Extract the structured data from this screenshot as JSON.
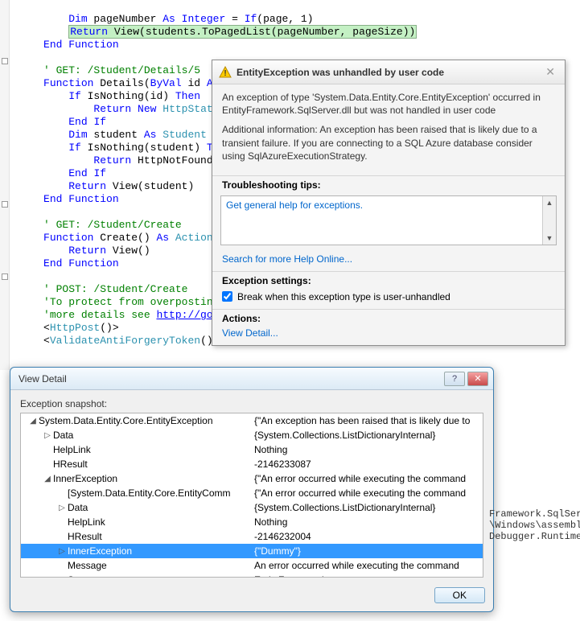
{
  "code": {
    "line1_a": "Dim",
    "line1_b": " pageNumber ",
    "line1_c": "As",
    "line1_d": " ",
    "line1_e": "Integer",
    "line1_f": " = ",
    "line1_g": "If",
    "line1_h": "(page, 1)",
    "line2_a": "Return",
    "line2_b": " View(students.ToPagedList(pageNumber, pageSize))",
    "line3_a": "End",
    "line3_b": " ",
    "line3_c": "Function",
    "line5": "' GET: /Student/Details/5",
    "line6_a": "Function",
    "line6_b": " Details(",
    "line6_c": "ByVal",
    "line6_d": " id ",
    "line6_e": "As",
    "line7_a": "If",
    "line7_b": " IsNothing(id) ",
    "line7_c": "Then",
    "line8_a": "Return",
    "line8_b": " ",
    "line8_c": "New",
    "line8_d": " ",
    "line8_e": "HttpStatu",
    "line9_a": "End",
    "line9_b": " ",
    "line9_c": "If",
    "line10_a": "Dim",
    "line10_b": " student ",
    "line10_c": "As",
    "line10_d": " ",
    "line10_e": "Student",
    "line10_f": " =",
    "line11_a": "If",
    "line11_b": " IsNothing(student) ",
    "line11_c": "Th",
    "line12_a": "Return",
    "line12_b": " HttpNotFound(",
    "line13_a": "End",
    "line13_b": " ",
    "line13_c": "If",
    "line14_a": "Return",
    "line14_b": " View(student)",
    "line15_a": "End",
    "line15_b": " ",
    "line15_c": "Function",
    "line17": "' GET: /Student/Create",
    "line18_a": "Function",
    "line18_b": " Create() ",
    "line18_c": "As",
    "line18_d": " ",
    "line18_e": "ActionR",
    "line19_a": "Return",
    "line19_b": " View()",
    "line20_a": "End",
    "line20_b": " ",
    "line20_c": "Function",
    "line22": "' POST: /Student/Create",
    "line23": "'To protect from overposting",
    "line24_a": "'more details see ",
    "line24_link": "http://go.",
    "line25": "<",
    "line25_b": "HttpPost",
    "line25_c": "()>",
    "line26": "<",
    "line26_b": "ValidateAntiForgeryToken",
    "line26_c": "()>"
  },
  "popup": {
    "title": "EntityException was unhandled by user code",
    "desc1": "An exception of type 'System.Data.Entity.Core.EntityException' occurred in EntityFramework.SqlServer.dll but was not handled in user code",
    "desc2": "Additional information: An exception has been raised that is likely due to a transient failure. If you are connecting to a SQL Azure database consider using SqlAzureExecutionStrategy.",
    "tips_title": "Troubleshooting tips:",
    "tips_link": "Get general help for exceptions.",
    "search_link": "Search for more Help Online...",
    "settings_title": "Exception settings:",
    "settings_check": "Break when this exception type is user-unhandled",
    "actions_title": "Actions:",
    "actions_link": "View Detail..."
  },
  "dialog": {
    "title": "View Detail",
    "snapshot_label": "Exception snapshot:",
    "ok_label": "OK",
    "rows": [
      {
        "indent": 0,
        "exp": "◢",
        "name": "System.Data.Entity.Core.EntityException",
        "val": "{\"An exception has been raised that is likely due to"
      },
      {
        "indent": 1,
        "exp": "▷",
        "name": "Data",
        "val": "{System.Collections.ListDictionaryInternal}"
      },
      {
        "indent": 1,
        "exp": "",
        "name": "HelpLink",
        "val": "Nothing"
      },
      {
        "indent": 1,
        "exp": "",
        "name": "HResult",
        "val": "-2146233087"
      },
      {
        "indent": 1,
        "exp": "◢",
        "name": "InnerException",
        "val": "{\"An error occurred while executing the command"
      },
      {
        "indent": 2,
        "exp": "",
        "name": "[System.Data.Entity.Core.EntityComm",
        "val": "{\"An error occurred while executing the command"
      },
      {
        "indent": 2,
        "exp": "▷",
        "name": "Data",
        "val": "{System.Collections.ListDictionaryInternal}"
      },
      {
        "indent": 2,
        "exp": "",
        "name": "HelpLink",
        "val": "Nothing"
      },
      {
        "indent": 2,
        "exp": "",
        "name": "HResult",
        "val": "-2146232004"
      },
      {
        "indent": 2,
        "exp": "▷",
        "name": "InnerException",
        "val": "{\"Dummy\"}",
        "selected": true
      },
      {
        "indent": 2,
        "exp": "",
        "name": "Message",
        "val": "An error occurred while executing the command "
      },
      {
        "indent": 2,
        "exp": "",
        "name": "Source",
        "val": "EntityFramework"
      }
    ]
  },
  "behind": {
    "l1": "Framework.SqlServe",
    "l2": "\\Windows\\assembly\\d",
    "l3": "Debugger.Runtime.d"
  }
}
